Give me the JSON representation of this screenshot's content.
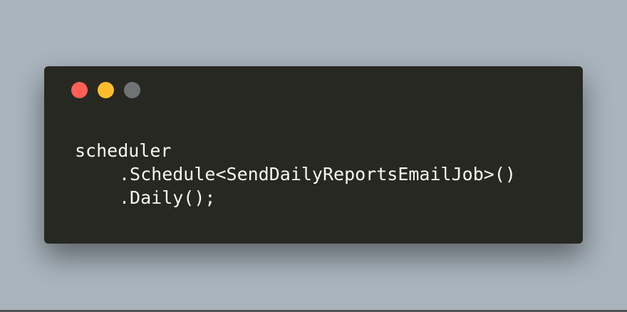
{
  "window": {
    "controls": [
      {
        "name": "close",
        "color": "#ff5f56"
      },
      {
        "name": "minimize",
        "color": "#ffbd2e"
      },
      {
        "name": "zoom",
        "color": "#6f7375"
      }
    ]
  },
  "code": {
    "lines": [
      "scheduler",
      ".Schedule<SendDailyReportsEmailJob>()",
      ".Daily();"
    ]
  }
}
